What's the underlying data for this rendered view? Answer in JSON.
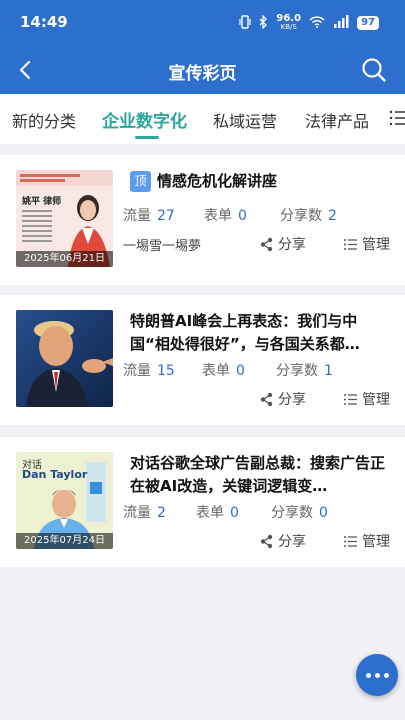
{
  "status_bar": {
    "time": "14:49",
    "net_speed": "96.0",
    "net_unit": "KB/S",
    "battery": "97"
  },
  "header": {
    "title": "宣传彩页"
  },
  "tabs": [
    {
      "label": "新的分类"
    },
    {
      "label": "企业数字化"
    },
    {
      "label": "私域运营"
    },
    {
      "label": "法律产品"
    }
  ],
  "labels": {
    "flow": "流量",
    "form": "表单",
    "shares": "分享数",
    "share": "分享",
    "manage": "管理",
    "top": "顶"
  },
  "cards": [
    {
      "title": "情感危机化解讲座",
      "flow": "27",
      "form": "0",
      "shares": "2",
      "author": "一埸雪一埸夢",
      "date": "2025年06月21日",
      "thumb_caption": "姚平 律师"
    },
    {
      "title": "特朗普AI峰会上再表态：我们与中国“相处得很好”，与各国关系都…",
      "flow": "15",
      "form": "0",
      "shares": "1",
      "date": ""
    },
    {
      "title": "对话谷歌全球广告副总裁：搜索广告正在被AI改造，关键词逻辑变…",
      "flow": "2",
      "form": "0",
      "shares": "0",
      "date": "2025年07月24日",
      "thumb_caption_1": "对话",
      "thumb_caption_2": "Dan Taylor"
    }
  ],
  "colors": {
    "primary": "#2d6fcd",
    "tab_active": "#2ba69a",
    "badge": "#5d9bf0"
  }
}
